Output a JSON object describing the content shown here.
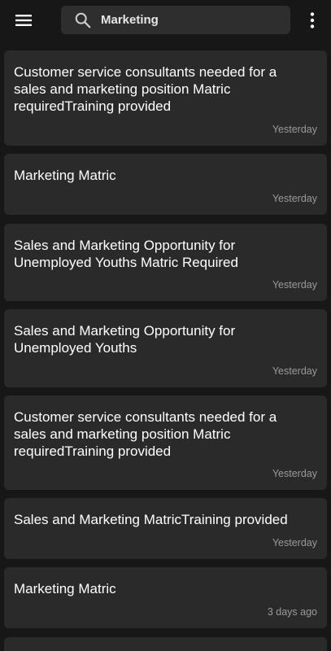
{
  "search": {
    "value": "Marketing",
    "placeholder": "Marketing"
  },
  "icons": {
    "menu": "menu-icon",
    "search": "search-icon",
    "more": "more-vertical-icon"
  },
  "colors": {
    "background": "#171717",
    "card": "#2a2a2a",
    "search_box": "#2e2e2e",
    "title_text": "#ffffff",
    "time_text": "#9a9a9a"
  },
  "listings": [
    {
      "title": "Customer service consultants needed for a sales and marketing position Matric requiredTraining provided",
      "time": "Yesterday"
    },
    {
      "title": "Marketing Matric",
      "time": "Yesterday"
    },
    {
      "title": "Sales and Marketing Opportunity for Unemployed Youths Matric Required",
      "time": "Yesterday"
    },
    {
      "title": "Sales and Marketing Opportunity for Unemployed Youths",
      "time": "Yesterday"
    },
    {
      "title": "Customer service consultants needed for a sales and marketing position Matric requiredTraining provided",
      "time": "Yesterday"
    },
    {
      "title": "Sales and Marketing MatricTraining provided",
      "time": "Yesterday"
    },
    {
      "title": "Marketing Matric",
      "time": "3 days ago"
    },
    {
      "title": "",
      "time": ""
    }
  ]
}
